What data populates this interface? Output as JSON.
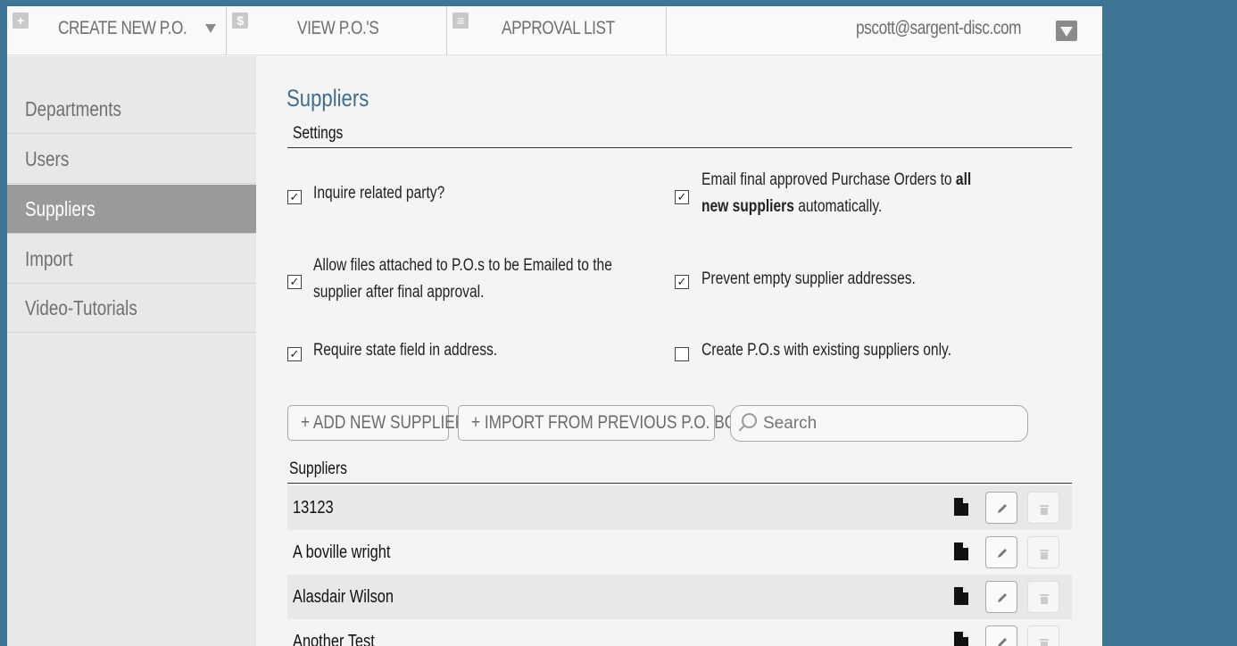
{
  "topnav": {
    "create": "CREATE NEW P.O.",
    "view": "VIEW P.O.'S",
    "approval": "APPROVAL LIST",
    "user": "pscott@sargent-disc.com",
    "icons": [
      "plus-icon",
      "dollar-icon",
      "list-icon"
    ]
  },
  "sidebar": {
    "items": [
      {
        "label": "Departments"
      },
      {
        "label": "Users"
      },
      {
        "label": "Suppliers"
      },
      {
        "label": "Import"
      },
      {
        "label": "Video-Tutorials"
      }
    ],
    "active": "Suppliers"
  },
  "main": {
    "title": "Suppliers",
    "settings_heading": "Settings",
    "options": [
      {
        "text": "Inquire related party?",
        "checked": true
      },
      {
        "text_before": "Email final approved Purchase Orders to ",
        "text_bold": "all new suppliers",
        "text_after": " automatically.",
        "checked": true
      },
      {
        "text": "Allow files attached to P.O.s to be Emailed to the supplier after final approval.",
        "checked": true
      },
      {
        "text": "Prevent empty supplier addresses.",
        "checked": true
      },
      {
        "text": "Require state field in address.",
        "checked": true
      },
      {
        "text": "Create P.O.s with existing suppliers only.",
        "checked": false
      }
    ],
    "add_button": "ADD NEW SUPPLIER",
    "import_button": "IMPORT FROM PREVIOUS P.O. BOOKS",
    "search_placeholder": "Search",
    "list_heading": "Suppliers",
    "suppliers": [
      "13123",
      "A boville wright",
      "Alasdair Wilson",
      "Another Test"
    ]
  },
  "colors": {
    "background": "#3f7594",
    "title": "#3f6f8c",
    "sidebar_active": "#9a9a9a"
  }
}
